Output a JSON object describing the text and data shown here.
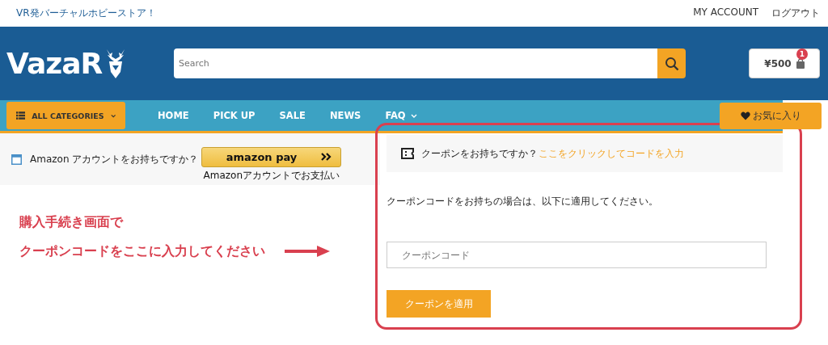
{
  "top_bar": {
    "tagline": "VR発バーチャルホビーストア！",
    "links": [
      "MY ACCOUNT",
      "ログアウト"
    ]
  },
  "header": {
    "logo": "VazaR",
    "search": {
      "placeholder": "Search"
    },
    "cart": {
      "total": "¥500",
      "count": "1"
    }
  },
  "nav": {
    "categories": "ALL CATEGORIES",
    "items": [
      {
        "label": "HOME",
        "dropdown": false
      },
      {
        "label": "PICK UP",
        "dropdown": false
      },
      {
        "label": "SALE",
        "dropdown": false
      },
      {
        "label": "NEWS",
        "dropdown": false
      },
      {
        "label": "FAQ",
        "dropdown": true
      }
    ],
    "favorites": "お気に入り"
  },
  "amazon": {
    "question": "Amazon アカウントをお持ちですか？",
    "button": "amazon pay",
    "caption": "Amazonアカウントでお支払い"
  },
  "annotation": {
    "lines": [
      "購入手続き画面で",
      "クーポンコードをここに入力してください"
    ]
  },
  "coupon": {
    "question": "クーポンをお持ちですか？",
    "link": "ここをクリックしてコードを入力",
    "instructions": "クーポンコードをお持ちの場合は、以下に適用してください。",
    "field": {
      "placeholder": "クーポンコード"
    },
    "button": "クーポンを適用"
  }
}
